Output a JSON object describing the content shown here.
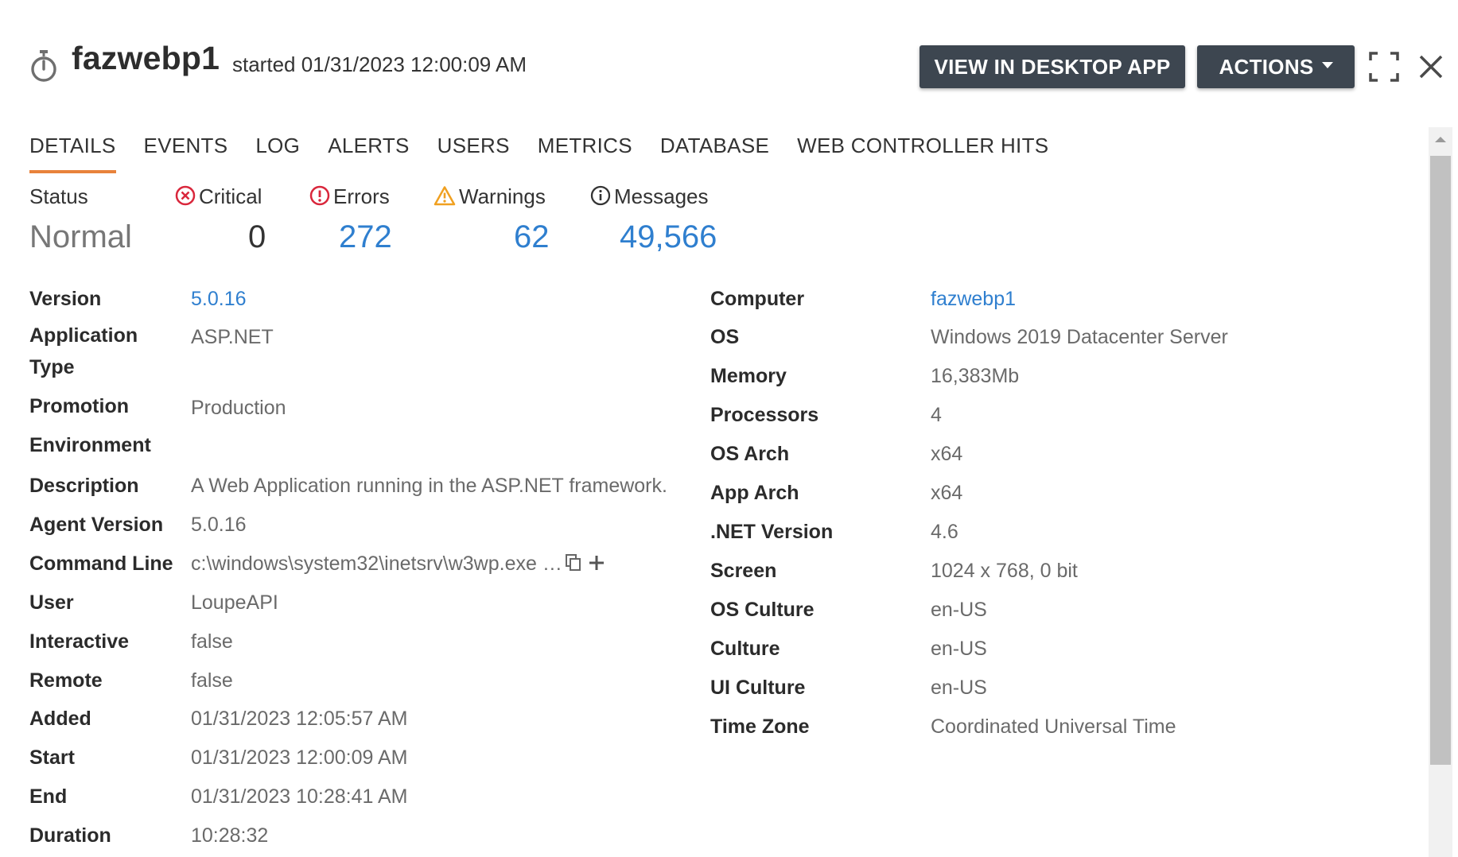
{
  "header": {
    "title": "fazwebp1",
    "subtitle": "started 01/31/2023 12:00:09 AM",
    "view_desktop_label": "VIEW IN DESKTOP APP",
    "actions_label": "ACTIONS"
  },
  "tabs": [
    {
      "label": "DETAILS",
      "active": true
    },
    {
      "label": "EVENTS"
    },
    {
      "label": "LOG"
    },
    {
      "label": "ALERTS"
    },
    {
      "label": "USERS"
    },
    {
      "label": "METRICS"
    },
    {
      "label": "DATABASE"
    },
    {
      "label": "WEB CONTROLLER HITS"
    }
  ],
  "summary": {
    "status_label": "Status",
    "status_value": "Normal",
    "critical_label": "Critical",
    "critical_value": "0",
    "errors_label": "Errors",
    "errors_value": "272",
    "warnings_label": "Warnings",
    "warnings_value": "62",
    "messages_label": "Messages",
    "messages_value": "49,566"
  },
  "details_left": [
    {
      "key": "Version",
      "value": "5.0.16"
    },
    {
      "key": "Application Type",
      "value": "ASP.NET"
    },
    {
      "key": "Promotion Environment",
      "value": "Production"
    },
    {
      "key": "Description",
      "value": "A Web Application running in the ASP.NET framework."
    },
    {
      "key": "Agent Version",
      "value": "5.0.16"
    },
    {
      "key": "Command Line",
      "value": "c:\\windows\\system32\\inetsrv\\w3wp.exe …"
    },
    {
      "key": "User",
      "value": "LoupeAPI"
    },
    {
      "key": "Interactive",
      "value": "false"
    },
    {
      "key": "Remote",
      "value": "false"
    },
    {
      "key": "Added",
      "value": "01/31/2023 12:05:57 AM"
    },
    {
      "key": "Start",
      "value": "01/31/2023 12:00:09 AM"
    },
    {
      "key": "End",
      "value": "01/31/2023 10:28:41 AM"
    },
    {
      "key": "Duration",
      "value": "10:28:32"
    }
  ],
  "details_right": [
    {
      "key": "Computer",
      "value": "fazwebp1"
    },
    {
      "key": "OS",
      "value": "Windows 2019 Datacenter Server"
    },
    {
      "key": "Memory",
      "value": "16,383Mb"
    },
    {
      "key": "Processors",
      "value": "4"
    },
    {
      "key": "OS Arch",
      "value": "x64"
    },
    {
      "key": "App Arch",
      "value": "x64"
    },
    {
      "key": ".NET Version",
      "value": "4.6"
    },
    {
      "key": "Screen",
      "value": "1024 x 768, 0 bit"
    },
    {
      "key": "OS Culture",
      "value": "en-US"
    },
    {
      "key": "Culture",
      "value": "en-US"
    },
    {
      "key": "UI Culture",
      "value": "en-US"
    },
    {
      "key": "Time Zone",
      "value": "Coordinated Universal Time"
    }
  ],
  "colors": {
    "accent_underline": "#e8823b",
    "link": "#2f7fcf",
    "critical": "#d9263b",
    "warning": "#f0a020",
    "button_bg": "#3d4650"
  },
  "icons": {
    "header": "stopwatch-icon",
    "critical": "circle-x-icon",
    "errors": "circle-exclamation-icon",
    "warnings": "triangle-warning-icon",
    "messages": "circle-info-icon",
    "command_line_copy": "copy-icon",
    "command_line_expand": "plus-icon",
    "expand": "expand-icon",
    "close": "close-icon"
  }
}
